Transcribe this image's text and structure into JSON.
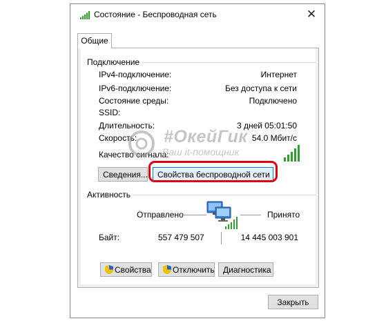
{
  "window": {
    "title": "Состояние - Беспроводная сеть",
    "close_glyph": "✕"
  },
  "tabs": [
    {
      "label": "Общие"
    }
  ],
  "connection": {
    "heading": "Подключение",
    "rows": [
      {
        "label": "IPv4-подключение:",
        "value": "Интернет"
      },
      {
        "label": "IPv6-подключение:",
        "value": "Без доступа к сети"
      },
      {
        "label": "Состояние среды:",
        "value": "Подключено"
      },
      {
        "label": "SSID:",
        "value": ""
      },
      {
        "label": "Длительность:",
        "value": "3 дней 05:01:50"
      },
      {
        "label": "Скорость:",
        "value": "54.0 Мбит/с"
      }
    ],
    "signal_label": "Качество сигнала:",
    "signal_bars": 5,
    "details_button": "Сведения...",
    "wireless_props_button": "Свойства беспроводной сети"
  },
  "activity": {
    "heading": "Активность",
    "sent_label": "Отправлено",
    "received_label": "Принято",
    "bytes_label": "Байт:",
    "bytes_sent": "557 479 507",
    "bytes_received": "14 445 003 901",
    "properties_button": "Свойства",
    "disable_button": "Отключить",
    "diagnose_button": "Диагностика"
  },
  "footer": {
    "close_button": "Закрыть"
  },
  "watermark": {
    "main": "#ОкейГик",
    "sub": "Ваш it-помощник"
  },
  "colors": {
    "accent": "#0078d7",
    "signal_green": "#2e9e2e",
    "highlight_red": "#e0000f",
    "shield_blue": "#2a62c9",
    "shield_yellow": "#f2c200"
  },
  "icons": [
    "wifi-signal-icon",
    "close-icon",
    "signal-strength-icon",
    "network-computers-icon",
    "shield-icon"
  ]
}
